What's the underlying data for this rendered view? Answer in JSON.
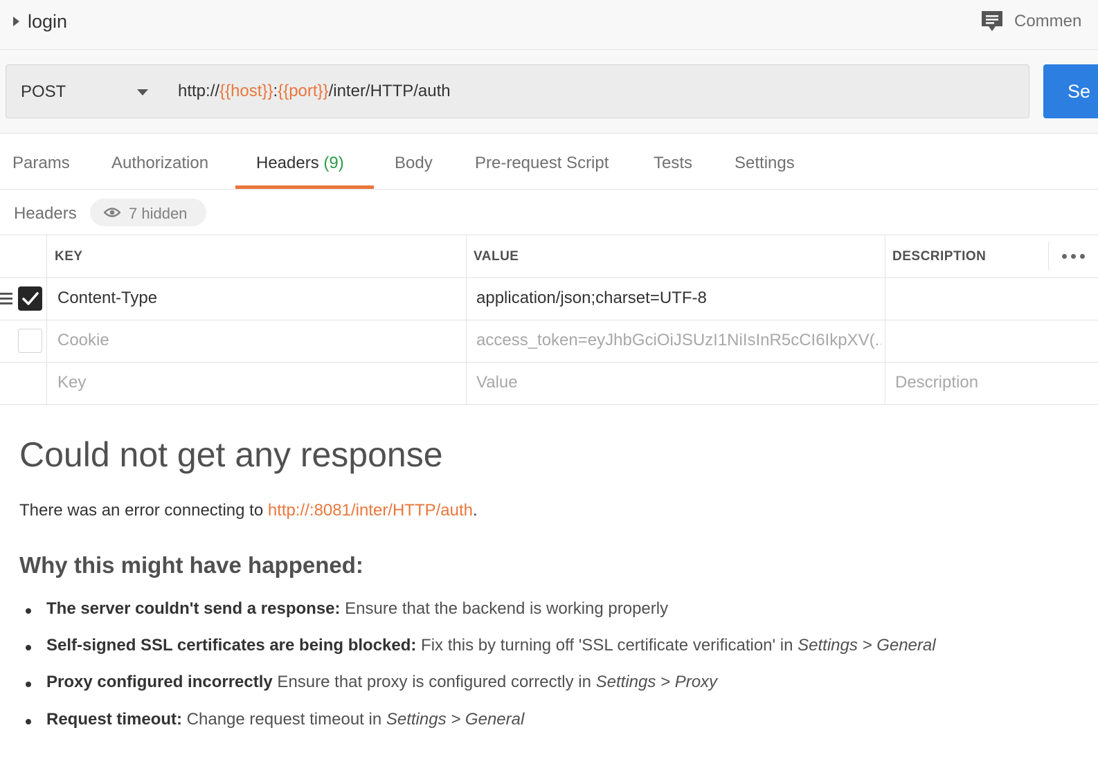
{
  "request": {
    "name": "login",
    "comments_label": "Commen"
  },
  "url_bar": {
    "method": "POST",
    "url_prefix": "http://",
    "url_var_host": "{{host}}",
    "url_colon": ":",
    "url_var_port": "{{port}}",
    "url_path": "/inter/HTTP/auth",
    "send_label": "Se"
  },
  "tabs": [
    {
      "label": "Params"
    },
    {
      "label": "Authorization"
    },
    {
      "label": "Headers",
      "count": "(9)",
      "active": true
    },
    {
      "label": "Body"
    },
    {
      "label": "Pre-request Script"
    },
    {
      "label": "Tests"
    },
    {
      "label": "Settings"
    }
  ],
  "headers_section": {
    "title": "Headers",
    "hidden_label": "7 hidden"
  },
  "table": {
    "columns": [
      "KEY",
      "VALUE",
      "DESCRIPTION"
    ],
    "rows": [
      {
        "checked": true,
        "key": "Content-Type",
        "value": "application/json;charset=UTF-8",
        "description": ""
      },
      {
        "checked": false,
        "key": "Cookie",
        "value": "access_token=eyJhbGciOiJSUzI1NiIsInR5cCI6IkpXV(...",
        "description": ""
      }
    ],
    "placeholders": {
      "key": "Key",
      "value": "Value",
      "description": "Description"
    }
  },
  "response": {
    "title": "Could not get any response",
    "desc_prefix": "There was an error connecting to ",
    "desc_link": "http://:8081/inter/HTTP/auth",
    "desc_suffix": ".",
    "why_title": "Why this might have happened:",
    "reasons": [
      {
        "bold": "The server couldn't send a response:",
        "text": " Ensure that the backend is working properly",
        "italic": ""
      },
      {
        "bold": "Self-signed SSL certificates are being blocked:",
        "text": " Fix this by turning off 'SSL certificate verification' in ",
        "italic": "Settings > General"
      },
      {
        "bold": "Proxy configured incorrectly",
        "text": " Ensure that proxy is configured correctly in ",
        "italic": "Settings > Proxy"
      },
      {
        "bold": "Request timeout:",
        "text": " Change request timeout in ",
        "italic": "Settings > General"
      }
    ]
  },
  "colors": {
    "accent_orange": "#e9773d",
    "send_blue": "#2c7ee1",
    "count_green": "#2b9c47"
  },
  "icons": {
    "title_caret": "caret-right-icon",
    "comments": "comment-icon",
    "method_dropdown": "chevron-down-icon",
    "hidden": "eye-icon",
    "more": "more-horizontal-icon",
    "drag": "drag-handle-icon",
    "checkbox": "checkbox-icon"
  }
}
